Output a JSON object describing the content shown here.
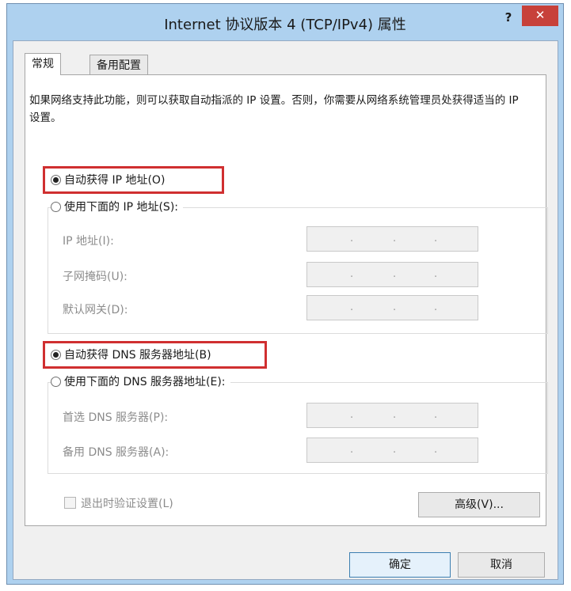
{
  "window": {
    "title": "Internet 协议版本 4 (TCP/IPv4) 属性",
    "help_label": "?",
    "close_label": "✕"
  },
  "tabs": [
    {
      "label": "常规",
      "active": true
    },
    {
      "label": "备用配置",
      "active": false
    }
  ],
  "description": "如果网络支持此功能，则可以获取自动指派的 IP 设置。否则，你需要从网络系统管理员处获得适当的 IP 设置。",
  "ip": {
    "auto_label": "自动获得 IP 地址(O)",
    "manual_label": "使用下面的 IP 地址(S):",
    "auto_selected": true,
    "fields": [
      {
        "label": "IP 地址(I):",
        "value": "  .   .   ."
      },
      {
        "label": "子网掩码(U):",
        "value": "  .   .   ."
      },
      {
        "label": "默认网关(D):",
        "value": "  .   .   ."
      }
    ]
  },
  "dns": {
    "auto_label": "自动获得 DNS 服务器地址(B)",
    "manual_label": "使用下面的 DNS 服务器地址(E):",
    "auto_selected": true,
    "fields": [
      {
        "label": "首选 DNS 服务器(P):",
        "value": "  .   .   ."
      },
      {
        "label": "备用 DNS 服务器(A):",
        "value": "  .   .   ."
      }
    ]
  },
  "validate_label": "退出时验证设置(L)",
  "buttons": {
    "advanced": "高级(V)...",
    "ok": "确定",
    "cancel": "取消"
  },
  "colors": {
    "highlight_box": "#d02f30",
    "title_bar": "#aed1ef",
    "close_button": "#c7413a"
  }
}
